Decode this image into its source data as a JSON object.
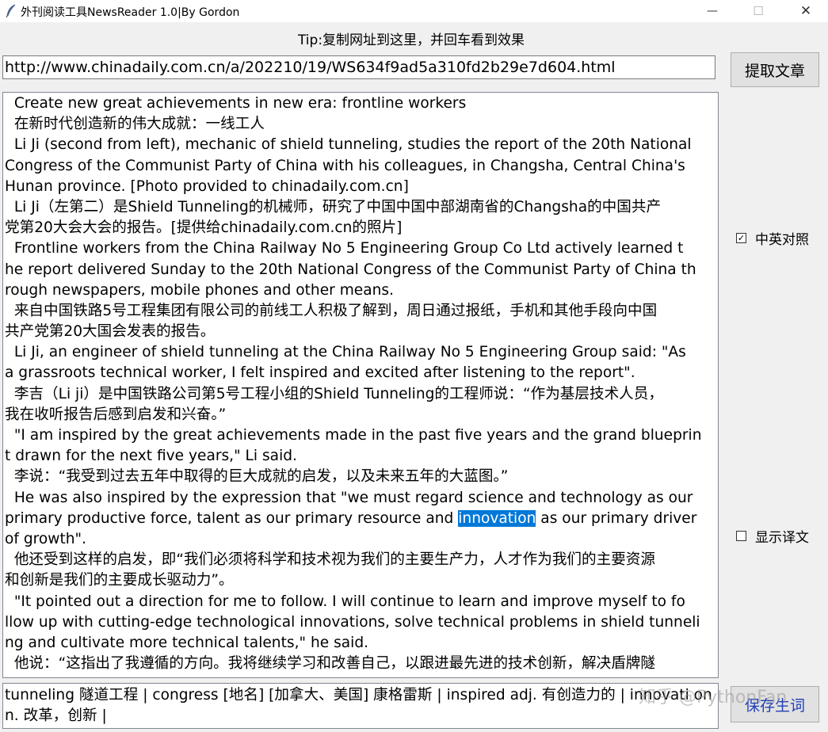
{
  "window": {
    "title": "外刊阅读工具NewsReader 1.0|By Gordon",
    "minimize_glyph": "—",
    "maximize_glyph": "☐",
    "close_glyph": "✕"
  },
  "tip": "Tip:复制网址到这里，并回车看到效果",
  "url_input": {
    "value": "http://www.chinadaily.com.cn/a/202210/19/WS634f9ad5a310fd2b29e7d604.html"
  },
  "extract_button": "提取文章",
  "article_lines": [
    "  Create new great achievements in new era: frontline workers",
    "  在新时代创造新的伟大成就：一线工人",
    "  Li Ji (second from left), mechanic of shield tunneling, studies the report of the 20th National",
    "Congress of the Communist Party of China with his colleagues, in Changsha, Central China's",
    "Hunan province. [Photo provided to chinadaily.com.cn]",
    "  Li Ji（左第二）是Shield Tunneling的机械师，研究了中国中国中部湖南省的Changsha的中国共产",
    "党第20大会大会的报告。[提供给chinadaily.com.cn的照片]",
    "  Frontline workers from the China Railway No 5 Engineering Group Co Ltd actively learned t",
    "he report delivered Sunday to the 20th National Congress of the Communist Party of China th",
    "rough newspapers, mobile phones and other means.",
    "  来自中国铁路5号工程集团有限公司的前线工人积极了解到，周日通过报纸，手机和其他手段向中国",
    "共产党第20大国会发表的报告。",
    "  Li Ji, an engineer of shield tunneling at the China Railway No 5 Engineering Group said: \"As",
    "a grassroots technical worker, I felt inspired and excited after listening to the report\".",
    "  李吉（Li ji）是中国铁路公司第5号工程小组的Shield Tunneling的工程师说：“作为基层技术人员，",
    "我在收听报告后感到启发和兴奋。”",
    "  \"I am inspired by the great achievements made in the past five years and the grand blueprin",
    "t drawn for the next five years,\" Li said.",
    "  李说：“我受到过去五年中取得的巨大成就的启发，以及未来五年的大蓝图。”",
    "  He was also inspired by the expression that \"we must regard science and technology as our",
    "of growth\".",
    "  他还受到这样的启发，即“我们必须将科学和技术视为我们的主要生产力，人才作为我们的主要资源",
    "和创新是我们的主要成长驱动力”。",
    "  \"It pointed out a direction for me to follow. I will continue to learn and improve myself to fo",
    "llow up with cutting-edge technological innovations, solve technical problems in shield tunneli",
    "ng and cultivate more technical talents,\" he said.",
    "  他说：“这指出了我遵循的方向。我将继续学习和改善自己，以跟进最先进的技术创新，解决盾牌隧"
  ],
  "highlight_line": {
    "before": "primary productive force, talent as our primary resource and ",
    "selected": "innovation",
    "after": " as our primary driver"
  },
  "checkboxes": {
    "bilingual": {
      "label": "中英对照",
      "checked": true,
      "mark": "✓"
    },
    "show_translation": {
      "label": "显示译文",
      "checked": false,
      "mark": ""
    }
  },
  "vocab_text": "tunneling 隧道工程 | congress [地名] [加拿大、美国] 康格雷斯 | inspired adj. 有创造力的 | innovati on n. 改革，创新 |",
  "save_button": "保存生词",
  "watermark": "知乎 @PythonFan"
}
